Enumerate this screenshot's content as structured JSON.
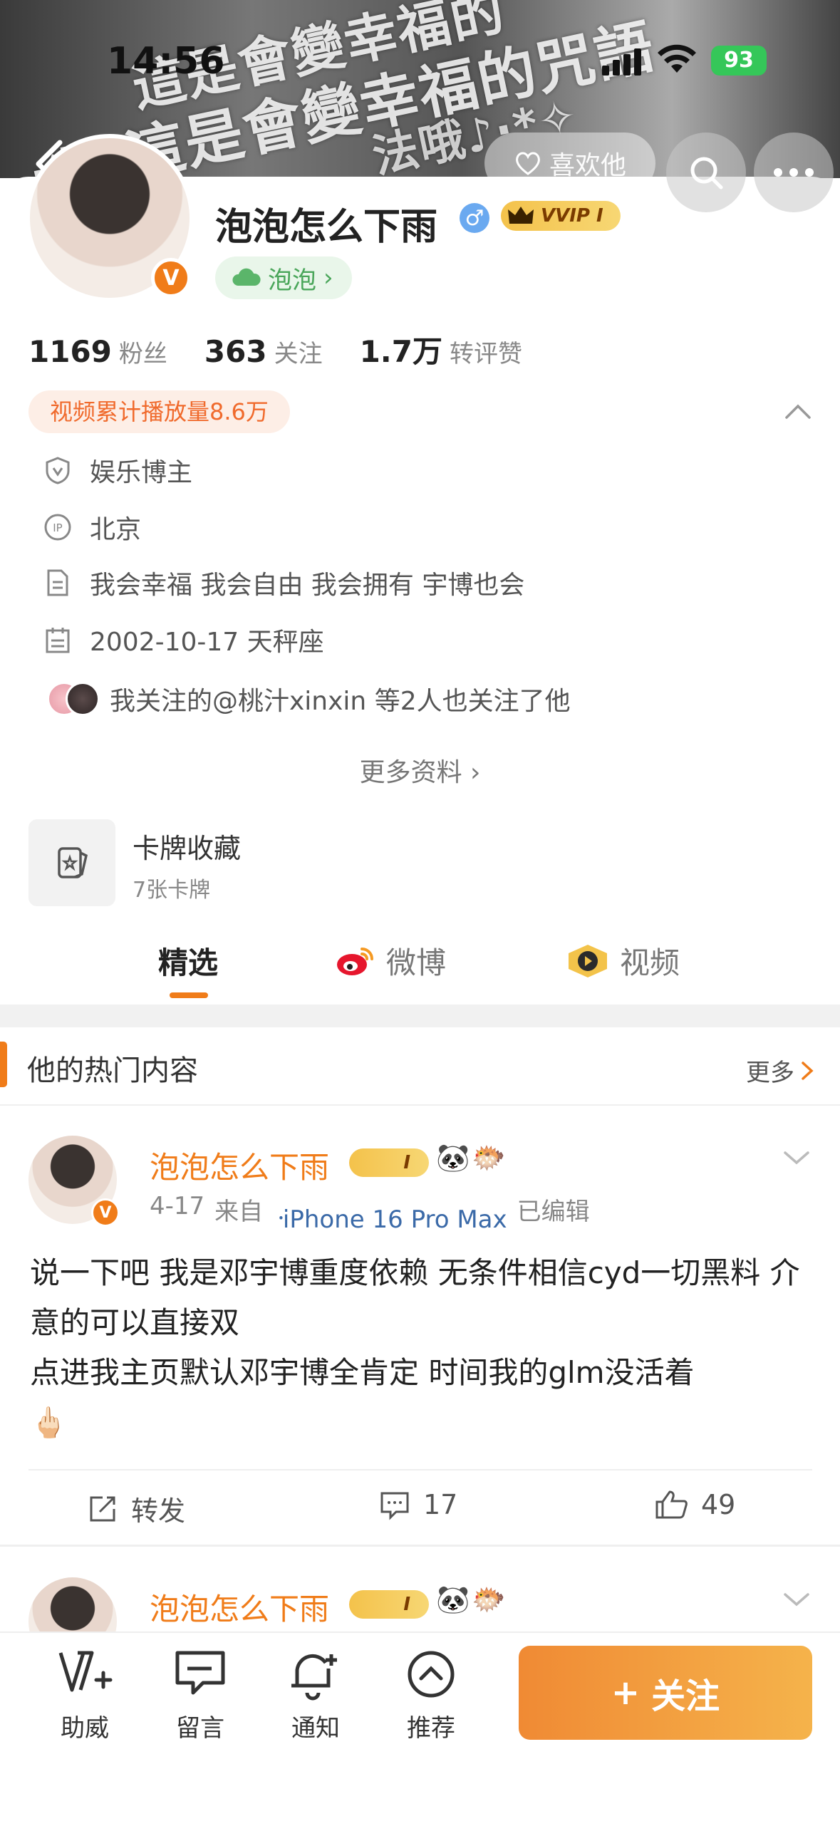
{
  "status_bar": {
    "time": "14:56",
    "battery": "93"
  },
  "banner": {
    "lines": [
      "這是會變幸福的",
      "·*ɞ這是會變幸福的咒語",
      "法哦♪·*✧"
    ],
    "like_label": "喜欢他"
  },
  "profile": {
    "name": "泡泡怎么下雨",
    "vip_label": "VVIP I",
    "bubble_label": "泡泡",
    "verified_badge": "V"
  },
  "stats": [
    {
      "num": "1169",
      "label": "粉丝"
    },
    {
      "num": "363",
      "label": "关注"
    },
    {
      "num": "1.7万",
      "label": "转评赞"
    }
  ],
  "play_count": "视频累计播放量8.6万",
  "info": {
    "category": "娱乐博主",
    "ip": "北京",
    "bio": "我会幸福 我会自由 我会拥有 宇博也会",
    "birthday": "2002-10-17 天秤座",
    "mutual_follow": "我关注的@桃汁xinxin 等2人也关注了他",
    "more_info": "更多资料"
  },
  "cards": {
    "title": "卡牌收藏",
    "subtitle": "7张卡牌"
  },
  "tabs": [
    "精选",
    "微博",
    "视频"
  ],
  "hot": {
    "title": "他的热门内容",
    "more": "更多"
  },
  "post": {
    "name": "泡泡怎么下雨",
    "level": "I",
    "date": "4-17",
    "from_label": "来自",
    "source": "iPhone 16 Pro Max",
    "edited": "已编辑",
    "body": "说一下吧 我是邓宇博重度依赖 无条件相信cyd一切黑料 介意的可以直接双\n点进我主页默认邓宇博全肯定 时间我的glm没活着\n🖕🏻",
    "actions": {
      "repost": "转发",
      "comments": "17",
      "likes": "49"
    }
  },
  "post2": {
    "name": "泡泡怎么下雨",
    "level": "I"
  },
  "bottom_bar": {
    "items": [
      "助威",
      "留言",
      "通知",
      "推荐"
    ],
    "follow": "关注"
  },
  "colors": {
    "accent": "#f07c19",
    "link": "#3b6aa8",
    "bubble_green": "#4aa65a"
  }
}
